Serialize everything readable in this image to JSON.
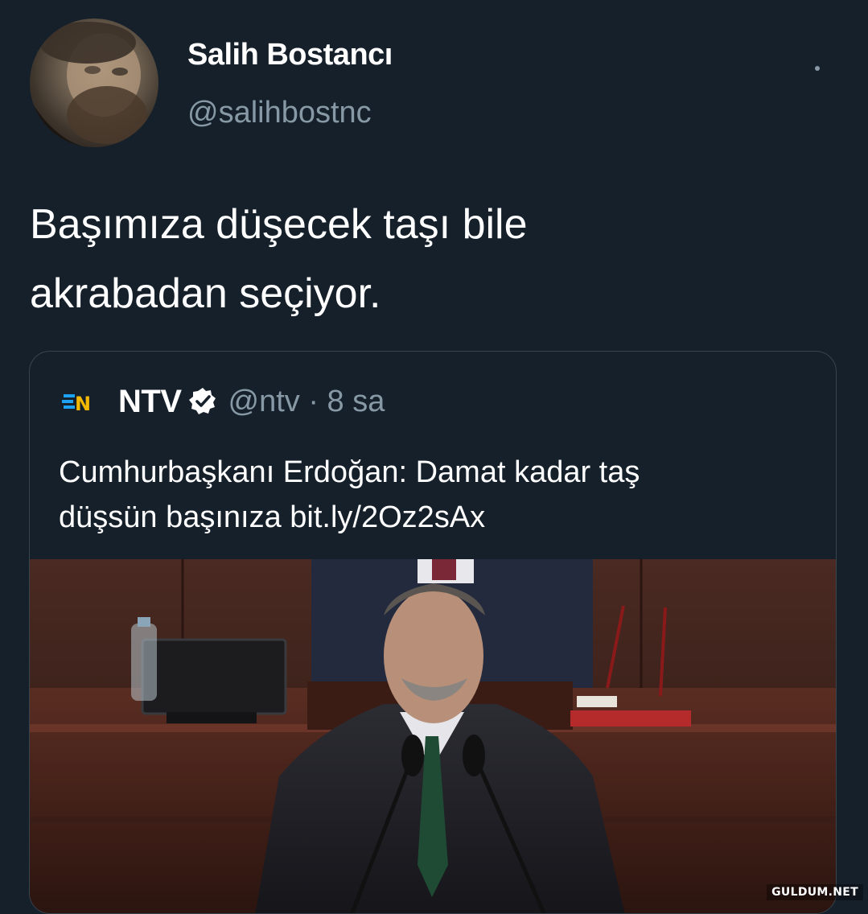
{
  "author": {
    "display_name": "Salih Bostancı",
    "handle": "@salihbostnc"
  },
  "tweet": {
    "text_lines": [
      "Başımıza düşecek taşı bile",
      "akrabadan seçiyor."
    ]
  },
  "quoted_tweet": {
    "account_name": "NTV",
    "meta": "@ntv · 8 sa",
    "text_lines": [
      "Cumhurbaşkanı Erdoğan: Damat kadar taş",
      "düşsün başınıza bit.ly/2Oz2sAx"
    ],
    "logo_icon": "ntv-logo-icon",
    "verified_icon": "verified-badge-icon"
  },
  "watermark": "GULDUM.NET",
  "colors": {
    "background": "#15202b",
    "secondary_text": "#8899a6",
    "card_border": "#38444d",
    "ntv_blue": "#1da1f2",
    "ntv_yellow": "#f5b800"
  }
}
